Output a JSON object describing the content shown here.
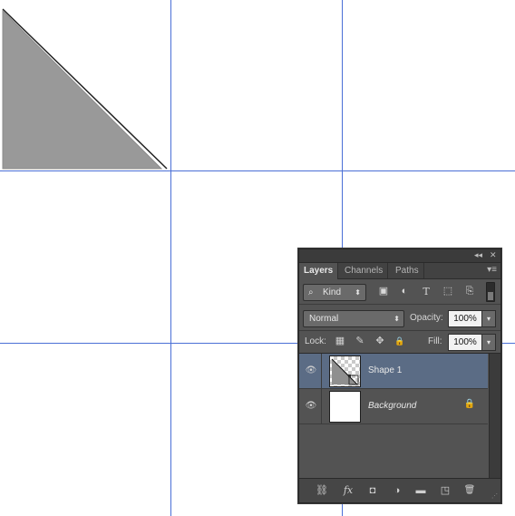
{
  "panel": {
    "title_controls": {
      "collapse_glyph": "◂◂",
      "close_glyph": "✕"
    },
    "tabs": [
      {
        "label": "Layers",
        "active": true
      },
      {
        "label": "Channels",
        "active": false
      },
      {
        "label": "Paths",
        "active": false
      }
    ],
    "menu_glyph": "▾≡",
    "filter": {
      "kind_label": "Kind",
      "search_icon": "⌕",
      "arrow": "⬍",
      "filter_icons": [
        {
          "name": "pixel-filter-icon",
          "glyph": "▣"
        },
        {
          "name": "adjustment-filter-icon",
          "glyph": "◐"
        },
        {
          "name": "type-filter-icon",
          "glyph": "T"
        },
        {
          "name": "shape-filter-icon",
          "glyph": "⬚"
        },
        {
          "name": "smart-object-filter-icon",
          "glyph": "⎘"
        }
      ]
    },
    "blend": {
      "mode": "Normal",
      "arrow": "⬍",
      "opacity_label": "Opacity:",
      "opacity_value": "100%",
      "fill_label": "Fill:",
      "fill_value": "100%",
      "dropdown_arrow": "▾"
    },
    "lock": {
      "label": "Lock:",
      "icons": [
        {
          "name": "lock-transparent-pixels-icon",
          "glyph": "▦"
        },
        {
          "name": "lock-image-pixels-icon",
          "glyph": "✎"
        },
        {
          "name": "lock-position-icon",
          "glyph": "✥"
        },
        {
          "name": "lock-all-icon",
          "glyph": "🔒"
        }
      ]
    },
    "layers": [
      {
        "name": "Shape 1",
        "selected": true,
        "visible_glyph": "👁",
        "italic": false
      },
      {
        "name": "Background",
        "selected": false,
        "visible_glyph": "👁",
        "italic": true,
        "lock_glyph": "🔒"
      }
    ],
    "bottom_icons": [
      {
        "name": "link-layers-icon",
        "glyph": "⛓"
      },
      {
        "name": "layer-style-icon",
        "glyph": "fx"
      },
      {
        "name": "add-mask-icon",
        "glyph": "◘"
      },
      {
        "name": "adjustment-layer-icon",
        "glyph": "◑"
      },
      {
        "name": "new-group-icon",
        "glyph": "▬"
      },
      {
        "name": "new-layer-icon",
        "glyph": "◳"
      },
      {
        "name": "delete-layer-icon",
        "glyph": "🗑"
      }
    ],
    "colors": {
      "selected_layer": "#5b6c85",
      "panel_bg": "#535353",
      "guide": "#4a6fd6",
      "shape_fill": "#999999"
    }
  }
}
